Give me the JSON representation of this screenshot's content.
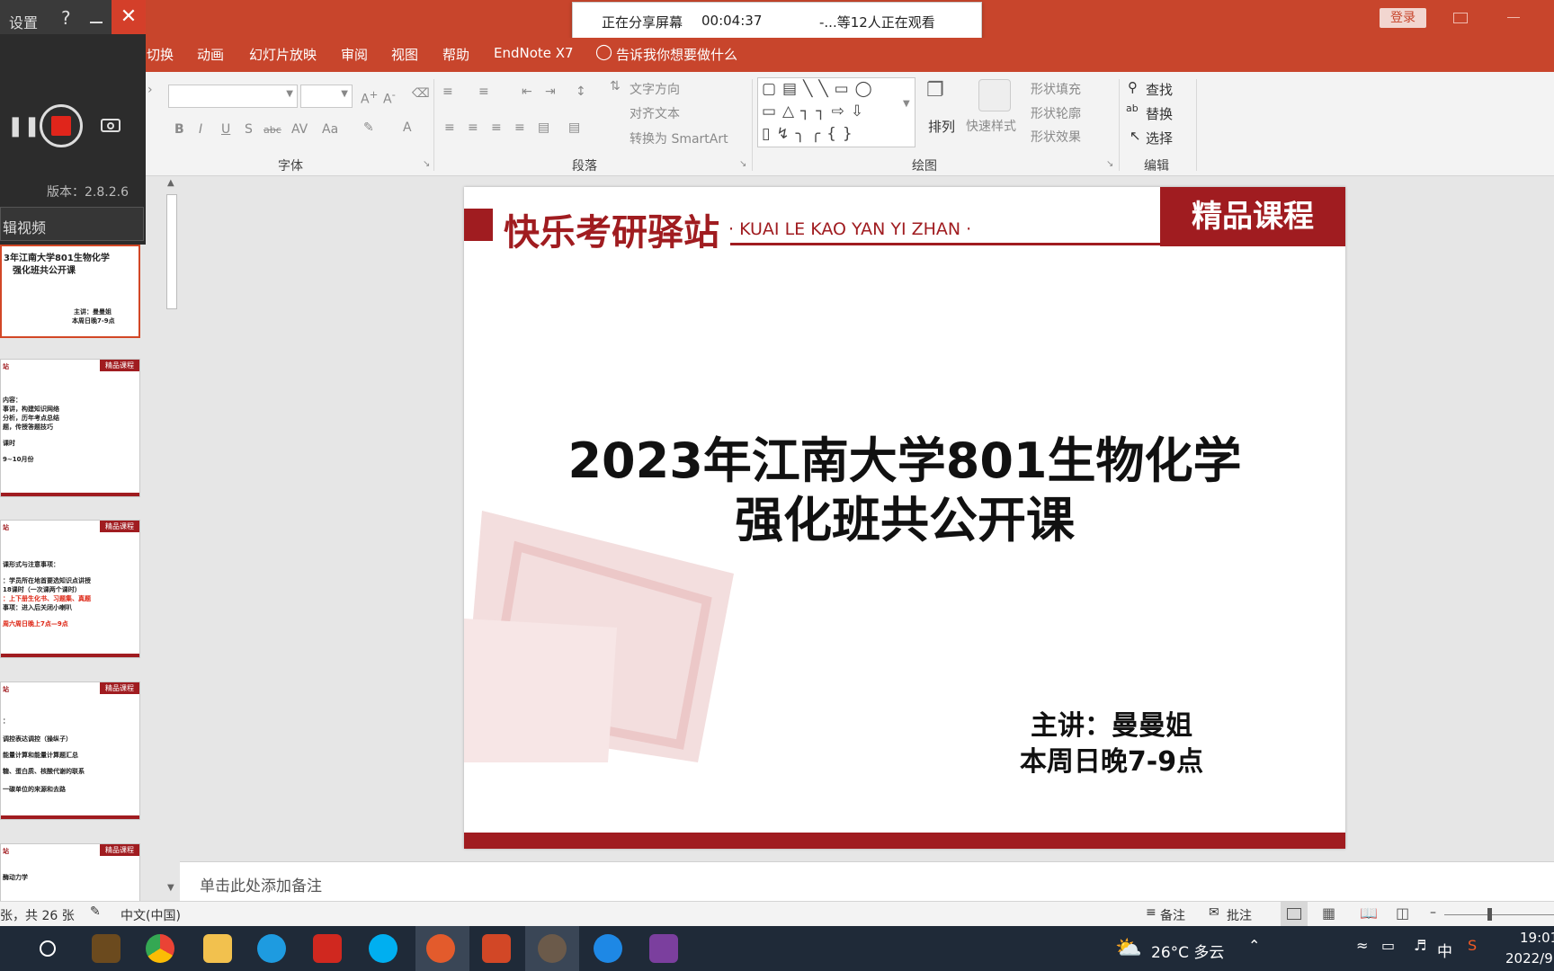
{
  "titlebar": {
    "login_label": "登录"
  },
  "share": {
    "status": "正在分享屏幕",
    "timer": "00:04:37",
    "viewers": "-...等12人正在观看"
  },
  "tabs": [
    "切换",
    "动画",
    "幻灯片放映",
    "审阅",
    "视图",
    "帮助",
    "EndNote X7"
  ],
  "tellme": "告诉我你想要做什么",
  "recorder": {
    "settings_label": "设置",
    "help_label": "?",
    "version": "版本：2.8.2.6",
    "edit_video": "辑视频"
  },
  "ribbon": {
    "groups": {
      "font": "字体",
      "paragraph": "段落",
      "drawing": "绘图",
      "editing": "编辑"
    },
    "paragraph_cmds": {
      "text_direction": "文字方向",
      "align_text": "对齐文本",
      "convert_smartart": "转换为 SmartArt"
    },
    "drawing_cmds": {
      "arrange": "排列",
      "quick_styles": "快速样式",
      "shape_fill": "形状填充",
      "shape_outline": "形状轮廓",
      "shape_effects": "形状效果"
    },
    "editing_cmds": {
      "find": "查找",
      "replace": "替换",
      "select": "选择"
    },
    "font_btns": [
      "B",
      "I",
      "U",
      "S",
      "abc",
      "AV",
      "Aa",
      "A"
    ]
  },
  "slide": {
    "brand_cn": "快乐考研驿站",
    "brand_en": "· KUAI LE KAO YAN YI ZHAN ·",
    "badge": "精品课程",
    "title_line1": "2023年江南大学801生物化学",
    "title_line2": "强化班共公开课",
    "presenter": "主讲：曼曼姐",
    "schedule": "本周日晚7-9点"
  },
  "thumbnails": [
    {
      "lines": [
        "3年江南大学801生物化学",
        "强化班共公开课",
        "主讲：曼曼姐",
        "本周日晚7-9点"
      ]
    },
    {
      "lines": [
        "站",
        "精品课程",
        "内容：",
        "事讲，构建知识网络",
        "分析，历年考点总结",
        "题，传授答题技巧",
        "课时",
        "9~10月份"
      ]
    },
    {
      "lines": [
        "站",
        "精品课程",
        "课形式与注意事项：",
        "：学员所在地首要选知识点讲授",
        "18课时（一次课两个课时）",
        "：上下册生化书、习题集、真题",
        "事项：进入后关闭小喇叭",
        "周六周日晚上7点—9点"
      ]
    },
    {
      "lines": [
        "站",
        "精品课程",
        "：",
        "调控表达调控（操纵子）",
        "能量计算和能量计算题汇总",
        "糖、蛋白质、核酸代谢的联系",
        "一碳单位的来源和去路"
      ]
    },
    {
      "lines": [
        "站",
        "精品课程",
        "酶动力学"
      ]
    }
  ],
  "notes_placeholder": "单击此处添加备注",
  "status": {
    "slide_count": "张，共 26 张",
    "language": "中文(中国)",
    "notes_btn": "备注",
    "comments_btn": "批注"
  },
  "taskbar": {
    "weather": "26°C  多云",
    "ime": "中",
    "time": "19:01",
    "date": "2022/9"
  }
}
